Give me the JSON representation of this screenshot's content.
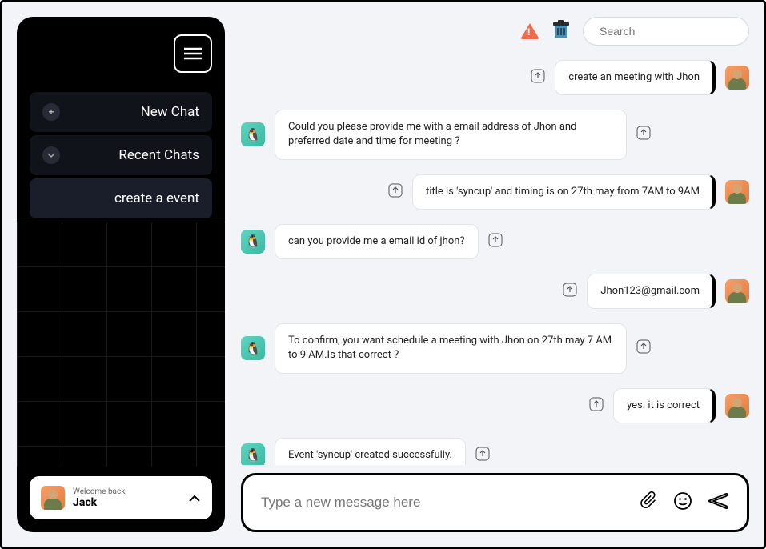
{
  "sidebar": {
    "new_chat_label": "New Chat",
    "recent_label": "Recent Chats",
    "active_item": "create a event"
  },
  "user_card": {
    "welcome": "Welcome back,",
    "name": "Jack"
  },
  "topbar": {
    "search_placeholder": "Search"
  },
  "messages": [
    {
      "role": "user",
      "text": "create an meeting with Jhon"
    },
    {
      "role": "bot",
      "text": "Could you please provide me with a email address of Jhon and preferred date and time for meeting ?"
    },
    {
      "role": "user",
      "text": "title is 'syncup' and timing is on 27th may from 7AM to 9AM"
    },
    {
      "role": "bot",
      "text": "can you provide me a email id of jhon?"
    },
    {
      "role": "user",
      "text": "Jhon123@gmail.com"
    },
    {
      "role": "bot",
      "text": "To confirm, you want schedule a meeting with Jhon on 27th may 7 AM to 9 AM.Is that correct ?"
    },
    {
      "role": "user",
      "text": "yes. it is correct"
    },
    {
      "role": "bot",
      "text": "Event 'syncup' created successfully."
    }
  ],
  "composer": {
    "placeholder": "Type a new message here"
  }
}
